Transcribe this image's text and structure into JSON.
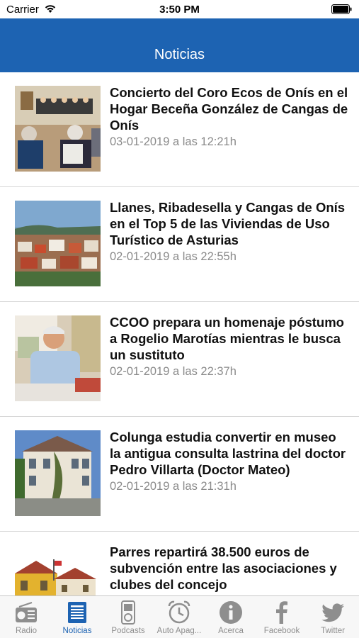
{
  "status_bar": {
    "carrier": "Carrier",
    "time": "3:50 PM",
    "wifi_icon": "wifi-icon",
    "battery_icon": "battery-icon"
  },
  "nav": {
    "title": "Noticias"
  },
  "news": [
    {
      "headline": "Concierto del Coro Ecos de Onís en el Hogar Beceña González de Cangas de Onís",
      "date": "03-01-2019 a las 12:21h"
    },
    {
      "headline": "Llanes, Ribadesella y Cangas de Onís en el Top 5 de las Viviendas de Uso Turístico de Asturias",
      "date": "02-01-2019 a las 22:55h"
    },
    {
      "headline": "CCOO prepara un homenaje póstumo a Rogelio Marotías mientras le busca un sustituto",
      "date": "02-01-2019 a las 22:37h"
    },
    {
      "headline": "Colunga estudia convertir en museo la antigua consulta lastrina del doctor Pedro Villarta (Doctor Mateo)",
      "date": "02-01-2019 a las 21:31h"
    },
    {
      "headline": "Parres repartirá 38.500 euros de subvención entre las asociaciones y clubes del concejo",
      "date": ""
    }
  ],
  "tabs": [
    {
      "label": "Radio",
      "icon": "radio-icon"
    },
    {
      "label": "Noticias",
      "icon": "news-icon",
      "active": true
    },
    {
      "label": "Podcasts",
      "icon": "ipod-icon"
    },
    {
      "label": "Auto Apag...",
      "icon": "alarm-clock-icon"
    },
    {
      "label": "Acerca",
      "icon": "info-icon"
    },
    {
      "label": "Facebook",
      "icon": "facebook-icon"
    },
    {
      "label": "Twitter",
      "icon": "twitter-icon"
    }
  ],
  "colors": {
    "nav_blue": "#1d63b2",
    "tab_inactive": "#8e8e8e"
  }
}
